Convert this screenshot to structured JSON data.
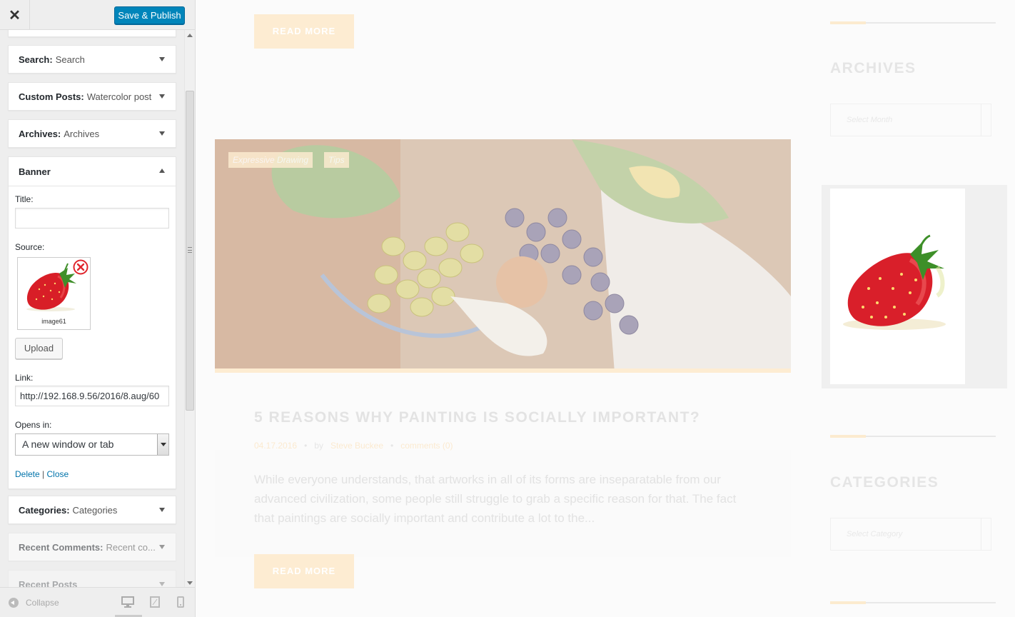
{
  "header": {
    "close_label": "✕",
    "publish_label": "Save & Publish"
  },
  "widgets": {
    "search": {
      "title": "Search:",
      "subtitle": "Search"
    },
    "custom_posts": {
      "title": "Custom Posts:",
      "subtitle": "Watercolor post"
    },
    "archives": {
      "title": "Archives:",
      "subtitle": "Archives"
    },
    "banner": {
      "title": "Banner",
      "title_label": "Title:",
      "title_value": "",
      "source_label": "Source:",
      "image_caption": "image61",
      "upload_label": "Upload",
      "link_label": "Link:",
      "link_value": "http://192.168.9.56/2016/8.aug/60",
      "opens_in_label": "Opens in:",
      "opens_in_value": "A new window or tab",
      "delete_label": "Delete",
      "separator": "|",
      "close_label": "Close"
    },
    "categories": {
      "title": "Categories:",
      "subtitle": "Categories"
    },
    "recent_comments": {
      "title": "Recent Comments:",
      "subtitle": "Recent co..."
    },
    "recent_posts": {
      "title": "Recent Posts",
      "subtitle": ""
    }
  },
  "footer": {
    "collapse_label": "Collapse"
  },
  "preview": {
    "read_more": "READ MORE",
    "tags": [
      "Expressive Drawing",
      "Tips"
    ],
    "post_title": "5 REASONS WHY PAINTING IS SOCIALLY IMPORTANT?",
    "post_date": "04.17.2016",
    "post_by": "by",
    "post_author": "Steve Buckee",
    "post_comments": "comments (0)",
    "excerpt": "While everyone understands, that artworks in all of its forms are inseparatable from our advanced civilization, some people still struggle to grab a specific reason for that. The fact that paintings are socially important and contribute a lot to the...",
    "archives_title": "ARCHIVES",
    "archives_select": "Select Month",
    "categories_title": "CATEGORIES",
    "categories_select": "Select Category"
  },
  "colors": {
    "accent_blue": "#0085ba",
    "link_blue": "#0073aa",
    "accent_cream": "#fdecd2",
    "remove_red": "#e0262d"
  }
}
